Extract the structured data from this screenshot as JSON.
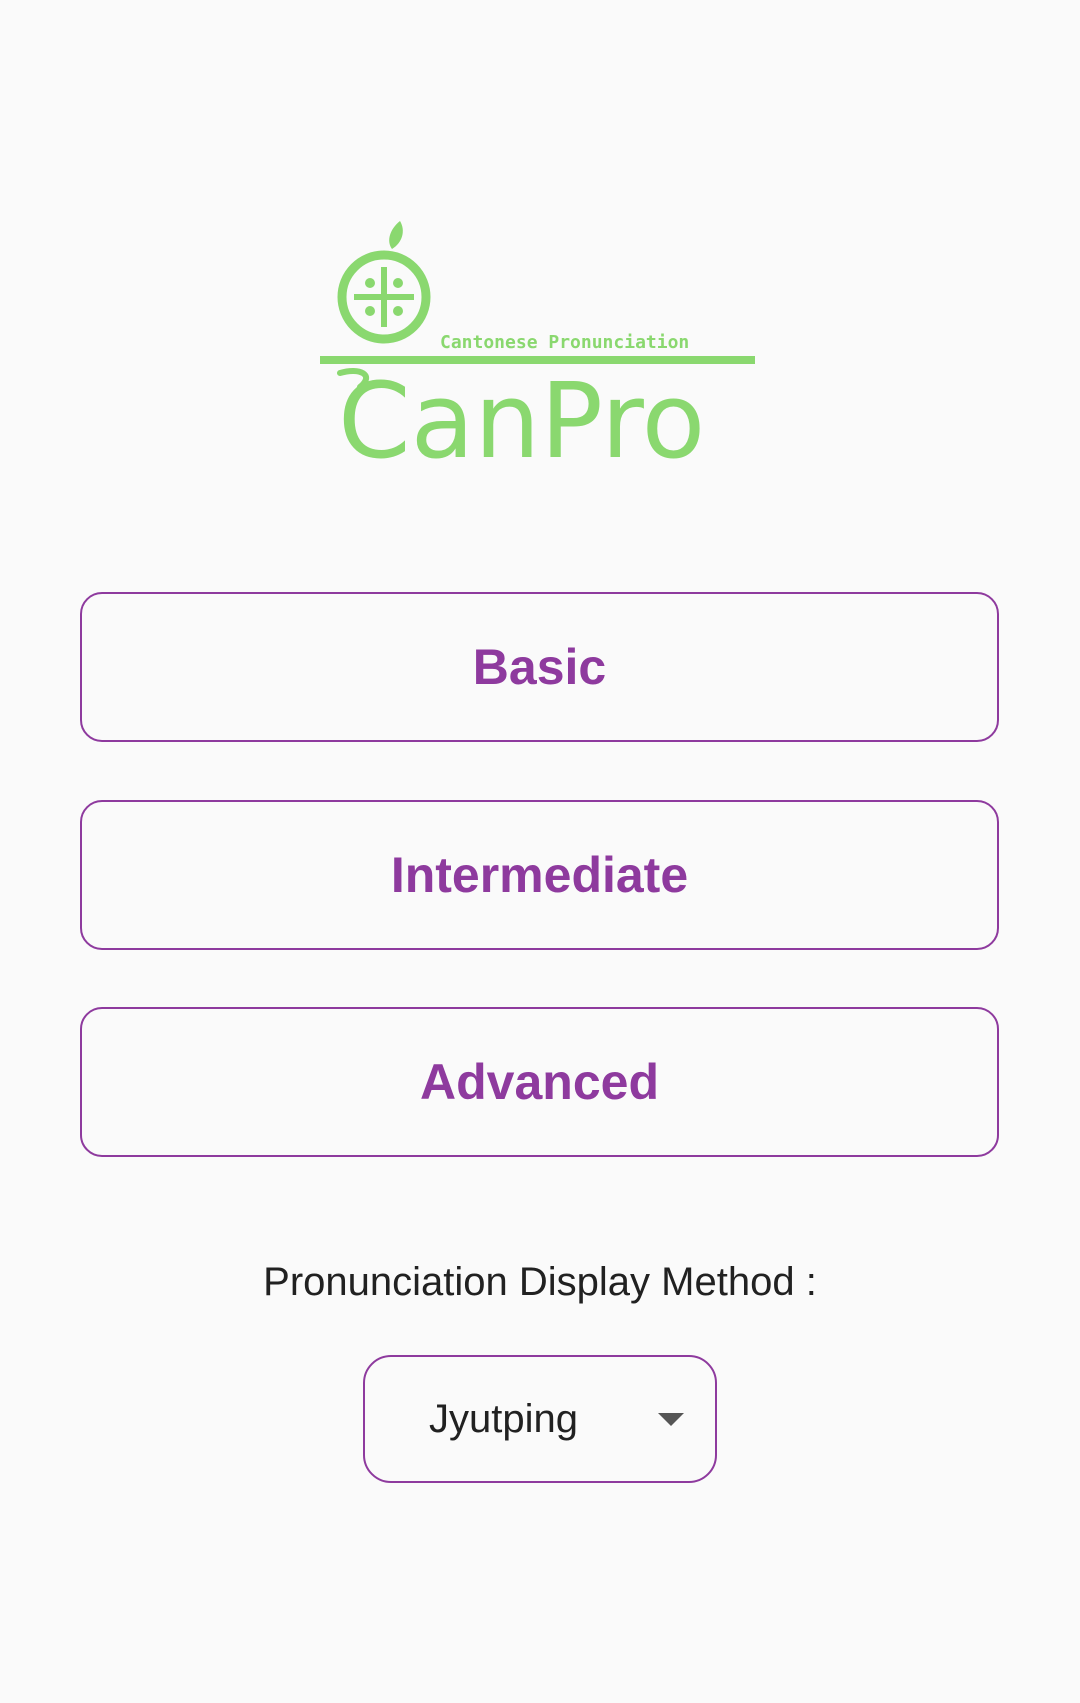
{
  "logo": {
    "tagline": "Cantonese Pronunciation",
    "name": "CanPro",
    "color": "#8ad86f"
  },
  "levels": [
    {
      "label": "Basic"
    },
    {
      "label": "Intermediate"
    },
    {
      "label": "Advanced"
    }
  ],
  "accent_color": "#8e3a9e",
  "display_method": {
    "label": "Pronunciation Display Method :",
    "selected": "Jyutping",
    "icon": "dropdown-arrow-icon"
  }
}
